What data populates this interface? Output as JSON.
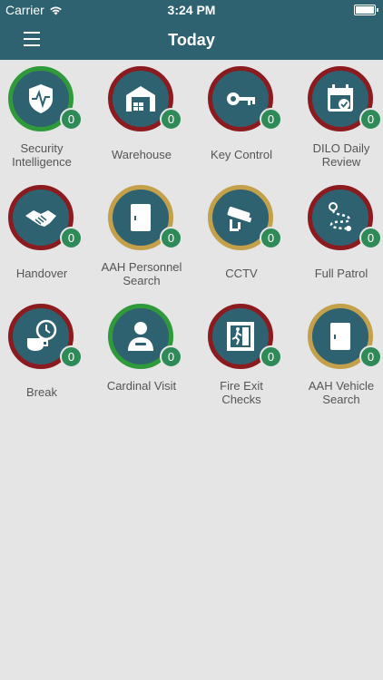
{
  "status_bar": {
    "carrier": "Carrier",
    "time": "3:24 PM"
  },
  "nav": {
    "title": "Today"
  },
  "tiles": [
    {
      "label": "Security Intelligence",
      "count": "0",
      "ring": "green",
      "icon": "shield-icon"
    },
    {
      "label": "Warehouse",
      "count": "0",
      "ring": "red",
      "icon": "warehouse-icon"
    },
    {
      "label": "Key Control",
      "count": "0",
      "ring": "red",
      "icon": "key-icon"
    },
    {
      "label": "DILO Daily Review",
      "count": "0",
      "ring": "red",
      "icon": "calendar-check-icon"
    },
    {
      "label": "Handover",
      "count": "0",
      "ring": "red",
      "icon": "handshake-icon"
    },
    {
      "label": "AAH Personnel Search",
      "count": "0",
      "ring": "gold",
      "icon": "door-icon"
    },
    {
      "label": "CCTV",
      "count": "0",
      "ring": "gold",
      "icon": "camera-icon"
    },
    {
      "label": "Full Patrol",
      "count": "0",
      "ring": "red",
      "icon": "route-icon"
    },
    {
      "label": "Break",
      "count": "0",
      "ring": "red",
      "icon": "coffee-clock-icon"
    },
    {
      "label": "Cardinal Visit",
      "count": "0",
      "ring": "green",
      "icon": "person-icon"
    },
    {
      "label": "Fire Exit Checks",
      "count": "0",
      "ring": "red",
      "icon": "fire-exit-icon"
    },
    {
      "label": "AAH Vehicle Search",
      "count": "0",
      "ring": "gold",
      "icon": "door-icon"
    }
  ],
  "colors": {
    "header": "#2f6270",
    "red_ring": "#8c1b1f",
    "green_ring": "#2e9a39",
    "gold_ring": "#c3a049",
    "badge": "#2e8b57"
  }
}
